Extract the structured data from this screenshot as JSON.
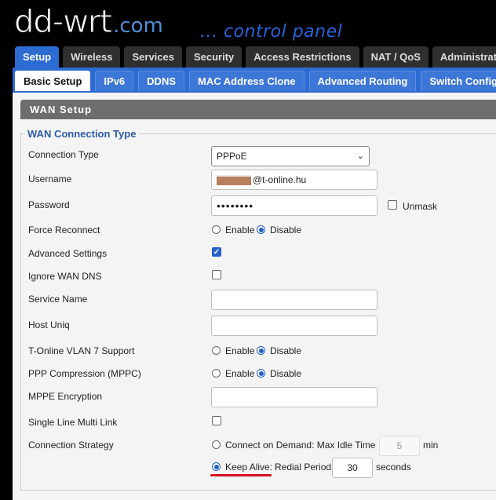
{
  "header": {
    "logo_main": "dd-wrt",
    "logo_domain": ".com",
    "tagline": "... control panel"
  },
  "main_tabs": [
    "Setup",
    "Wireless",
    "Services",
    "Security",
    "Access Restrictions",
    "NAT / QoS",
    "Administrati"
  ],
  "sub_tabs": [
    "Basic Setup",
    "IPv6",
    "DDNS",
    "MAC Address Clone",
    "Advanced Routing",
    "Switch Config"
  ],
  "section": {
    "title": "WAN Setup",
    "legend": "WAN Connection Type"
  },
  "form": {
    "connection_type": {
      "label": "Connection Type",
      "value": "PPPoE"
    },
    "username": {
      "label": "Username",
      "value": "@t-online.hu"
    },
    "password": {
      "label": "Password",
      "value": "••••••••",
      "unmask_label": "Unmask"
    },
    "force_reconnect": {
      "label": "Force Reconnect",
      "opt1": "Enable",
      "opt2": "Disable"
    },
    "advanced_settings": {
      "label": "Advanced Settings",
      "checked": true
    },
    "ignore_wan_dns": {
      "label": "Ignore WAN DNS",
      "checked": false
    },
    "service_name": {
      "label": "Service Name",
      "value": ""
    },
    "host_uniq": {
      "label": "Host Uniq",
      "value": ""
    },
    "tonline_vlan7": {
      "label": "T-Online VLAN 7 Support",
      "opt1": "Enable",
      "opt2": "Disable"
    },
    "ppp_compression": {
      "label": "PPP Compression (MPPC)",
      "opt1": "Enable",
      "opt2": "Disable"
    },
    "mppe_encryption": {
      "label": "MPPE Encryption",
      "value": ""
    },
    "single_line_multilink": {
      "label": "Single Line Multi Link",
      "checked": false
    },
    "connection_strategy": {
      "label": "Connection Strategy",
      "on_demand_label": "Connect on Demand: Max Idle Time",
      "idle_value": "5",
      "idle_unit": "min",
      "keep_alive_label": "Keep Alive:",
      "redial_label": "Redial Period",
      "redial_value": "30",
      "redial_unit": "seconds"
    }
  },
  "colors": {
    "accent": "#2c6bd1",
    "highlight_underline": "#d81020",
    "legend": "#2d5ba8"
  }
}
